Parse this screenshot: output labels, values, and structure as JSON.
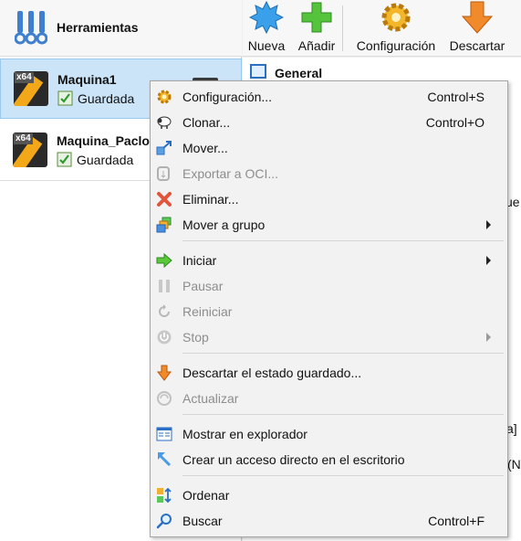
{
  "left": {
    "tools_title": "Herramientas",
    "vms": [
      {
        "name": "Maquina1",
        "state": "Guardada",
        "os_tag": "x64"
      },
      {
        "name": "Maquina_Paclon",
        "state": "Guardada",
        "os_tag": "x64"
      }
    ]
  },
  "toolbar": {
    "nueva": "Nueva",
    "anadir": "Añadir",
    "configuracion": "Configuración",
    "descartar": "Descartar"
  },
  "details": {
    "general_title": "General",
    "frag1": "ue",
    "frag2": "a]",
    "frag3": "(N"
  },
  "menu": {
    "items": [
      {
        "label": "Configuración...",
        "shortcut": "Control+S",
        "enabled": true,
        "icon": "gear-icon"
      },
      {
        "label": "Clonar...",
        "shortcut": "Control+O",
        "enabled": true,
        "icon": "sheep-icon"
      },
      {
        "label": "Mover...",
        "shortcut": "",
        "enabled": true,
        "icon": "move-icon"
      },
      {
        "label": "Exportar a OCI...",
        "shortcut": "",
        "enabled": false,
        "icon": "export-cloud-icon"
      },
      {
        "label": "Eliminar...",
        "shortcut": "",
        "enabled": true,
        "icon": "delete-x-icon"
      },
      {
        "label": "Mover a grupo",
        "shortcut": "",
        "enabled": true,
        "icon": "group-icon",
        "submenu": true
      },
      {
        "label": "Iniciar",
        "shortcut": "",
        "enabled": true,
        "icon": "start-arrow-icon",
        "submenu": true
      },
      {
        "label": "Pausar",
        "shortcut": "",
        "enabled": false,
        "icon": "pause-icon"
      },
      {
        "label": "Reiniciar",
        "shortcut": "",
        "enabled": false,
        "icon": "reset-icon"
      },
      {
        "label": "Stop",
        "shortcut": "",
        "enabled": false,
        "icon": "power-icon",
        "submenu": true
      },
      {
        "label": "Descartar el estado guardado...",
        "shortcut": "",
        "enabled": true,
        "icon": "discard-arrow-icon"
      },
      {
        "label": "Actualizar",
        "shortcut": "",
        "enabled": false,
        "icon": "refresh-icon"
      },
      {
        "label": "Mostrar en explorador",
        "shortcut": "",
        "enabled": true,
        "icon": "explorer-icon"
      },
      {
        "label": "Crear un acceso directo en el escritorio",
        "shortcut": "",
        "enabled": true,
        "icon": "shortcut-icon"
      },
      {
        "label": "Ordenar",
        "shortcut": "",
        "enabled": true,
        "icon": "sort-icon"
      },
      {
        "label": "Buscar",
        "shortcut": "Control+F",
        "enabled": true,
        "icon": "search-icon"
      }
    ]
  },
  "colors": {
    "selection": "#cce4f7",
    "menu_bg": "#f2f2f2",
    "disabled_text": "#8d8d8d"
  }
}
